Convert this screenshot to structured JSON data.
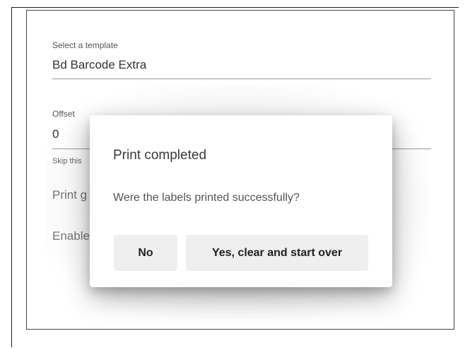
{
  "form": {
    "template_label": "Select a template",
    "template_value": "Bd Barcode Extra",
    "offset_label": "Offset",
    "offset_value": "0",
    "skip_label": "Skip this",
    "print_text": "Print g",
    "enable_text": "Enable"
  },
  "dialog": {
    "title": "Print completed",
    "message": "Were the labels printed successfully?",
    "no_label": "No",
    "yes_label": "Yes, clear and start over"
  }
}
